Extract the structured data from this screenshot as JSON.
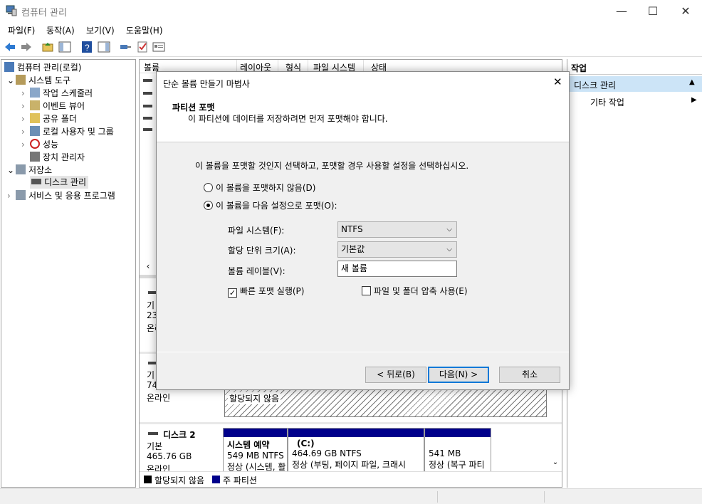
{
  "window": {
    "title": "컴퓨터 관리",
    "minimize": "—",
    "maximize": "☐",
    "close": "✕"
  },
  "menu": [
    "파일(F)",
    "동작(A)",
    "보기(V)",
    "도움말(H)"
  ],
  "tree": {
    "root": "컴퓨터 관리(로컬)",
    "system_tools": "시스템 도구",
    "task_scheduler": "작업 스케줄러",
    "event_viewer": "이벤트 뷰어",
    "shared_folders": "공유 폴더",
    "local_users": "로컬 사용자 및 그룹",
    "performance": "성능",
    "device_manager": "장치 관리자",
    "storage": "저장소",
    "disk_management": "디스크 관리",
    "services": "서비스 및 응용 프로그램"
  },
  "volume_table": {
    "columns": [
      "볼륨",
      "레이아웃",
      "형식",
      "파일 시스템",
      "상태"
    ]
  },
  "disks": {
    "disk0": {
      "line1": "기",
      "line2": "23",
      "line3": "온라"
    },
    "disk1": {
      "line1": "기",
      "line2": "74",
      "line3": "온라인",
      "unallocated": "할당되지 않음"
    },
    "disk2": {
      "name": "디스크 2",
      "type": "기본",
      "size": "465.76 GB",
      "status": "온라인",
      "partitions": [
        {
          "name": "시스템 예약",
          "size": "549 MB NTFS",
          "status": "정상 (시스템, 활"
        },
        {
          "name": "(C:)",
          "size": "464.69 GB NTFS",
          "status": "정상 (부팅, 페이지 파일, 크래시"
        },
        {
          "name": "",
          "size": "541 MB",
          "status": "정상 (복구 파티"
        }
      ]
    },
    "legend": {
      "unallocated": "할당되지 않음",
      "primary": "주 파티션"
    }
  },
  "actions": {
    "title": "작업",
    "disk_management": "디스크 관리",
    "more": "기타 작업"
  },
  "dialog": {
    "title": "단순 볼륨 만들기 마법사",
    "heading": "파티션 포맷",
    "subheading": "이 파티션에 데이터를 저장하려면 먼저 포맷해야 합니다.",
    "instruction": "이 볼륨을 포맷할 것인지 선택하고, 포맷할 경우 사용할 설정을 선택하십시오.",
    "radio_no_format": "이 볼륨을 포맷하지 않음(D)",
    "radio_format": "이 볼륨을 다음 설정으로 포맷(O):",
    "fs_label": "파일 시스템(F):",
    "fs_value": "NTFS",
    "alloc_label": "할당 단위 크기(A):",
    "alloc_value": "기본값",
    "vol_label": "볼륨 레이블(V):",
    "vol_value": "새 볼륨",
    "quick_format": "빠른 포맷 실행(P)",
    "quick_format_checked": true,
    "compression": "파일 및 폴더 압축 사용(E)",
    "compression_checked": false,
    "back": "< 뒤로(B)",
    "next": "다음(N) >",
    "cancel": "취소"
  },
  "colors": {
    "primary_partition": "#00008b",
    "selected": "#cce8ff",
    "actions_header": "#dfe8f5"
  }
}
